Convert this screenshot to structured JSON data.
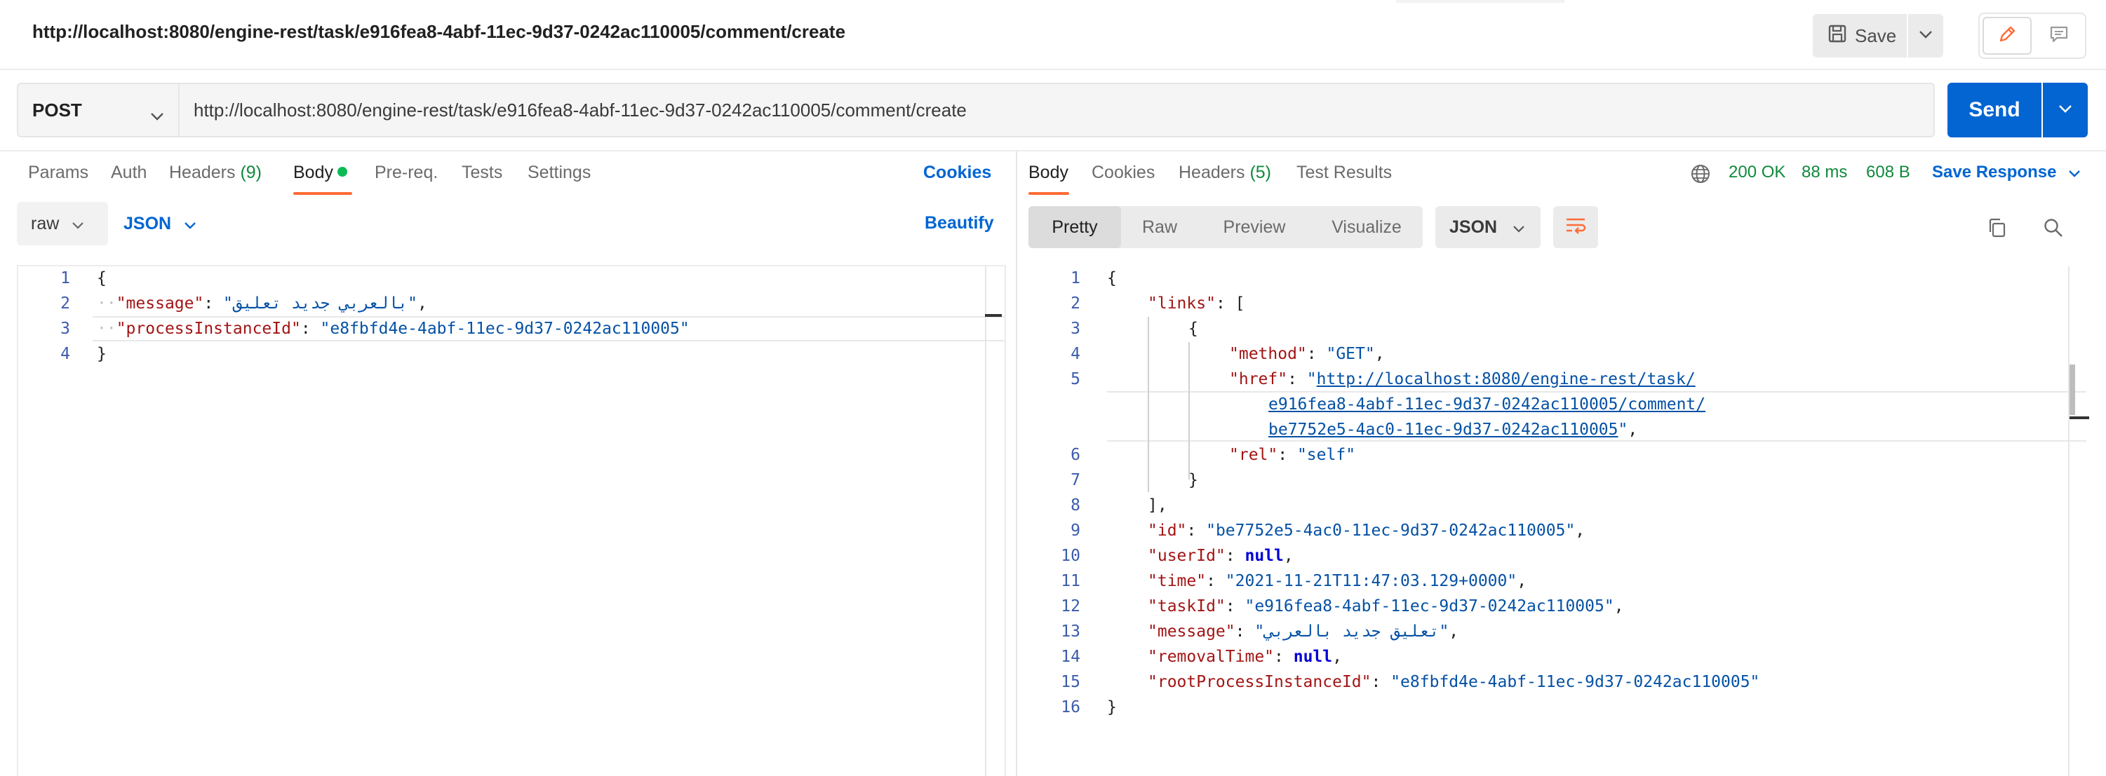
{
  "title": "http://localhost:8080/engine-rest/task/e916fea8-4abf-11ec-9d37-0242ac110005/comment/create",
  "toolbar": {
    "save_label": "Save"
  },
  "request": {
    "method": "POST",
    "url": "http://localhost:8080/engine-rest/task/e916fea8-4abf-11ec-9d37-0242ac110005/comment/create",
    "send_label": "Send",
    "tabs": {
      "params": "Params",
      "auth": "Auth",
      "headers": "Headers",
      "headers_count": "(9)",
      "body": "Body",
      "prereq": "Pre-req.",
      "tests": "Tests",
      "settings": "Settings"
    },
    "cookies_link": "Cookies",
    "body_mode": "raw",
    "body_lang": "JSON",
    "beautify_link": "Beautify",
    "code": {
      "open": "{",
      "close": "}",
      "message_key": "\"message\"",
      "message_val": "\"بالعربي جديد تعليق\"",
      "pid_key": "\"processInstanceId\"",
      "pid_val": "\"e8fbfd4e-4abf-11ec-9d37-0242ac110005\""
    }
  },
  "response": {
    "tabs": {
      "body": "Body",
      "cookies": "Cookies",
      "headers": "Headers",
      "headers_count": "(5)",
      "test_results": "Test Results"
    },
    "status": "200 OK",
    "time": "88 ms",
    "size": "608 B",
    "save_response": "Save Response",
    "view_tabs": {
      "pretty": "Pretty",
      "raw": "Raw",
      "preview": "Preview",
      "visualize": "Visualize"
    },
    "format": "JSON",
    "code": {
      "open": "{",
      "close": "}",
      "links_key": "\"links\"",
      "arr_open": "[",
      "arr_close": "],",
      "obj_open": "{",
      "obj_close": "}",
      "method_key": "\"method\"",
      "method_val": "\"GET\"",
      "href_key": "\"href\"",
      "href_val_1": "http://localhost:8080/engine-rest/task/",
      "href_val_2": "e916fea8-4abf-11ec-9d37-0242ac110005/comment/",
      "href_val_3": "be7752e5-4ac0-11ec-9d37-0242ac110005",
      "rel_key": "\"rel\"",
      "rel_val": "\"self\"",
      "id_key": "\"id\"",
      "id_val": "\"be7752e5-4ac0-11ec-9d37-0242ac110005\"",
      "userId_key": "\"userId\"",
      "null": "null",
      "time_key": "\"time\"",
      "time_val": "\"2021-11-21T11:47:03.129+0000\"",
      "taskId_key": "\"taskId\"",
      "taskId_val": "\"e916fea8-4abf-11ec-9d37-0242ac110005\"",
      "message_key": "\"message\"",
      "message_val": "\"تعليق جديد بالعربي\"",
      "removal_key": "\"removalTime\"",
      "root_key": "\"rootProcessInstanceId\"",
      "root_val": "\"e8fbfd4e-4abf-11ec-9d37-0242ac110005\""
    }
  },
  "line_numbers": {
    "left": [
      "1",
      "2",
      "3",
      "4"
    ],
    "right": [
      "1",
      "2",
      "3",
      "4",
      "5",
      "6",
      "7",
      "8",
      "9",
      "10",
      "11",
      "12",
      "13",
      "14",
      "15",
      "16"
    ]
  },
  "icons": {
    "save": "floppy-disk-icon",
    "caret": "chevron-down-icon",
    "edit": "pencil-icon",
    "comment": "comment-icon",
    "globe": "globe-icon",
    "wrap": "wrap-lines-icon",
    "copy": "copy-icon",
    "search": "search-icon"
  },
  "colors": {
    "accent": "#ff6c37",
    "primary": "#0265d2",
    "success": "#0f8a3d",
    "json_key": "#a31515",
    "json_string": "#0451a5"
  }
}
